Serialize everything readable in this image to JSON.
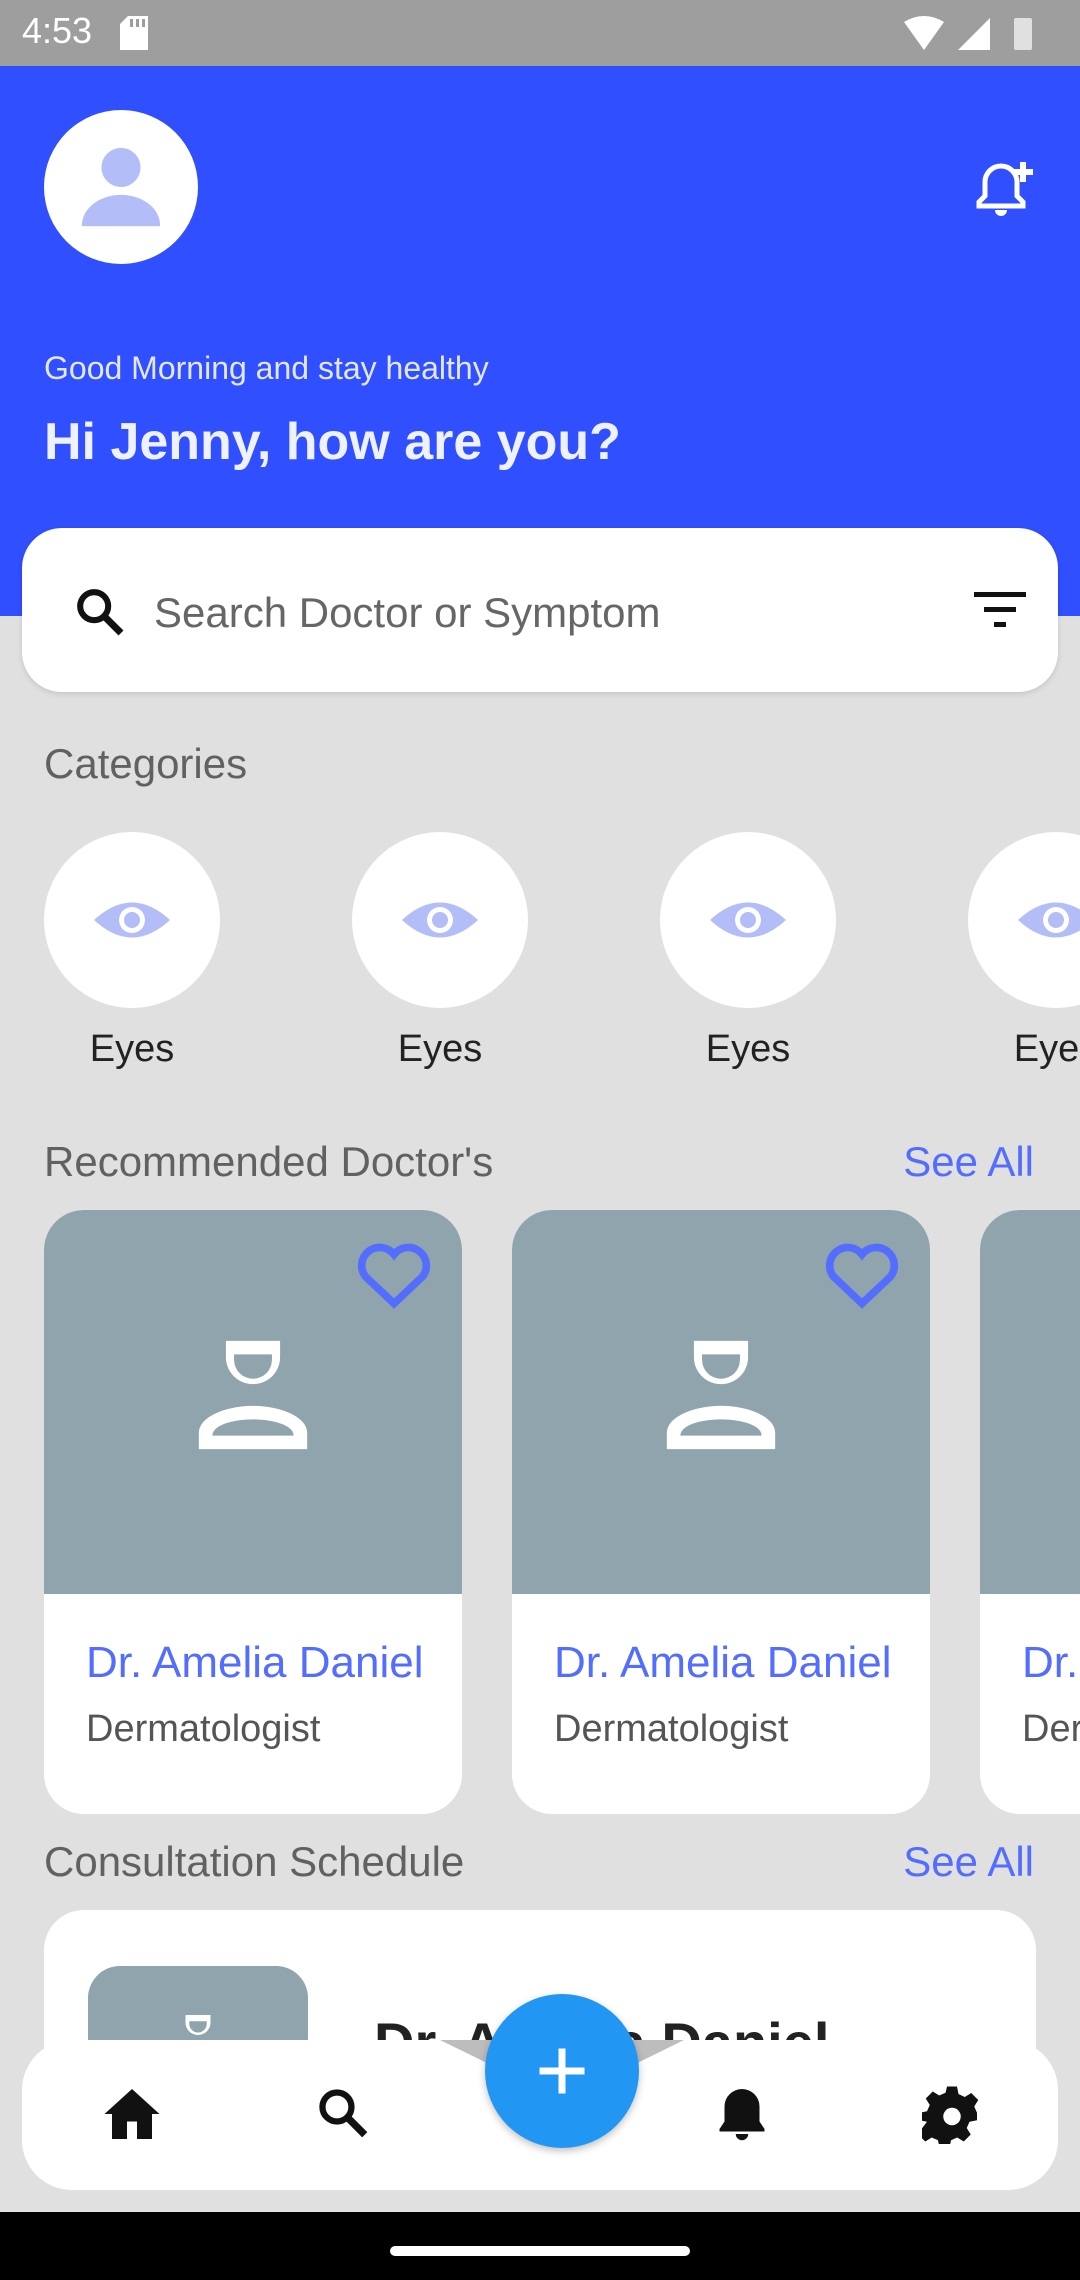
{
  "status": {
    "time": "4:53"
  },
  "header": {
    "greeting_small": "Good Morning and stay healthy",
    "greeting_big": "Hi Jenny, how are you?"
  },
  "search": {
    "placeholder": "Search Doctor or Symptom"
  },
  "categories": {
    "title": "Categories",
    "items": [
      {
        "label": "Eyes",
        "icon": "eye-icon"
      },
      {
        "label": "Eyes",
        "icon": "eye-icon"
      },
      {
        "label": "Eyes",
        "icon": "eye-icon"
      },
      {
        "label": "Eyes",
        "icon": "eye-icon"
      }
    ]
  },
  "recommended": {
    "title": "Recommended Doctor's",
    "see_all": "See All",
    "doctors": [
      {
        "name": "Dr. Amelia Daniel",
        "specialty": "Dermatologist"
      },
      {
        "name": "Dr. Amelia Daniel",
        "specialty": "Dermatologist"
      },
      {
        "name": "Dr. Amelia Daniel",
        "specialty": "Dermatologist"
      }
    ]
  },
  "consultation": {
    "title": "Consultation Schedule",
    "see_all": "See All",
    "first_name": "Dr. Amelia Daniel"
  },
  "colors": {
    "primary": "#304ffe",
    "accent": "#536dfe",
    "fab": "#2196f3",
    "card_image": "#90a4ae"
  },
  "nav": [
    "home-icon",
    "search-icon",
    "add-icon",
    "bell-icon",
    "settings-icon"
  ]
}
